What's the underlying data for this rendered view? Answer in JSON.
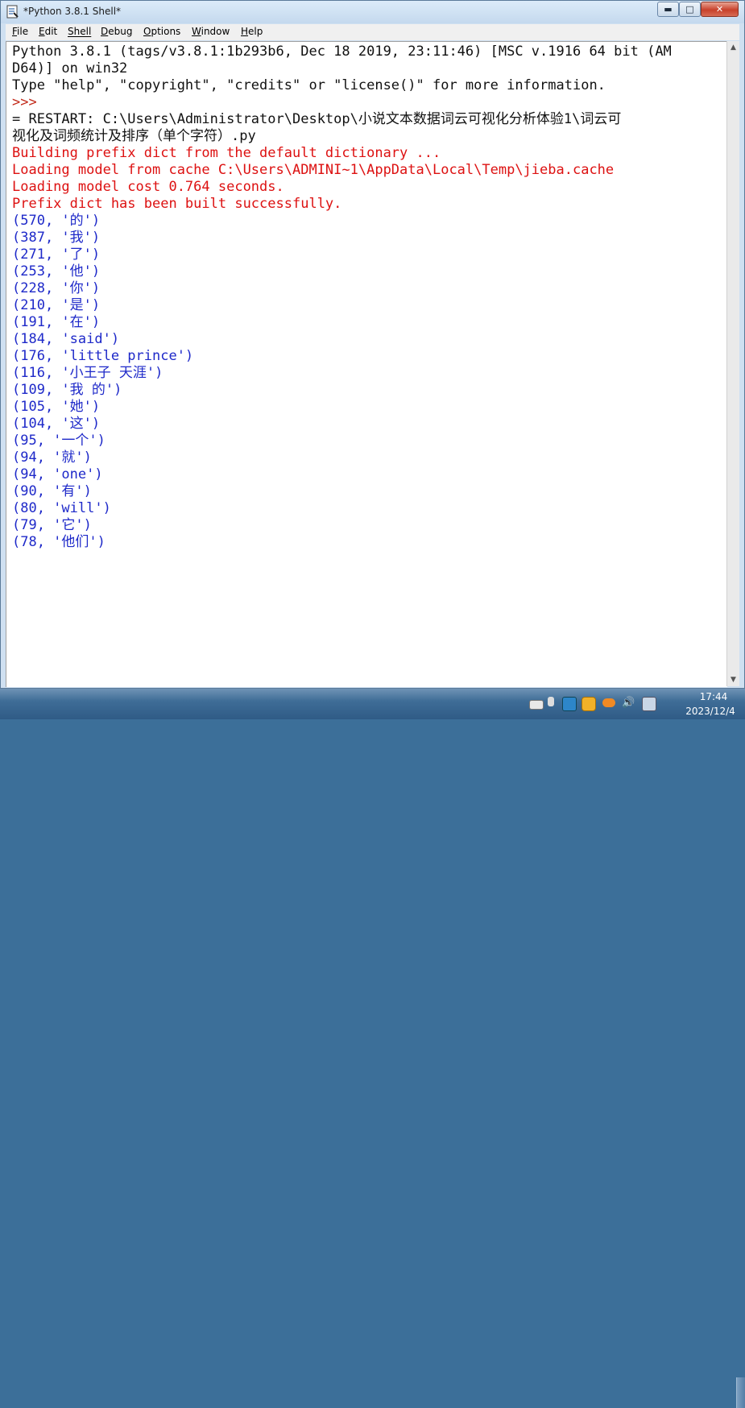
{
  "window": {
    "title": "*Python 3.8.1 Shell*",
    "controls": {
      "minimize": "▬",
      "maximize": "□",
      "close": "✕"
    }
  },
  "menubar": {
    "items": [
      {
        "label": "File",
        "mnemonic": "F",
        "rest": "ile"
      },
      {
        "label": "Edit",
        "mnemonic": "E",
        "rest": "dit"
      },
      {
        "label": "Shell",
        "mnemonic": "",
        "rest": "Shell"
      },
      {
        "label": "Debug",
        "mnemonic": "D",
        "rest": "ebug"
      },
      {
        "label": "Options",
        "mnemonic": "O",
        "rest": "ptions"
      },
      {
        "label": "Window",
        "mnemonic": "W",
        "rest": "indow"
      },
      {
        "label": "Help",
        "mnemonic": "H",
        "rest": "elp"
      }
    ]
  },
  "shell": {
    "lines": [
      {
        "kind": "out",
        "text": "Python 3.8.1 (tags/v3.8.1:1b293b6, Dec 18 2019, 23:11:46) [MSC v.1916 64 bit (AM"
      },
      {
        "kind": "out",
        "text": "D64)] on win32"
      },
      {
        "kind": "out",
        "text": "Type \"help\", \"copyright\", \"credits\" or \"license()\" for more information."
      },
      {
        "kind": "prompt",
        "text": ">>>"
      },
      {
        "kind": "out",
        "text": "= RESTART: C:\\Users\\Administrator\\Desktop\\小说文本数据词云可视化分析体验1\\词云可"
      },
      {
        "kind": "out",
        "text": "视化及词频统计及排序（单个字符）.py"
      },
      {
        "kind": "err",
        "text": "Building prefix dict from the default dictionary ..."
      },
      {
        "kind": "err",
        "text": "Loading model from cache C:\\Users\\ADMINI~1\\AppData\\Local\\Temp\\jieba.cache"
      },
      {
        "kind": "err",
        "text": "Loading model cost 0.764 seconds."
      },
      {
        "kind": "err",
        "text": "Prefix dict has been built successfully."
      },
      {
        "kind": "res",
        "text": "(570, '的')"
      },
      {
        "kind": "res",
        "text": "(387, '我')"
      },
      {
        "kind": "res",
        "text": "(271, '了')"
      },
      {
        "kind": "res",
        "text": "(253, '他')"
      },
      {
        "kind": "res",
        "text": "(228, '你')"
      },
      {
        "kind": "res",
        "text": "(210, '是')"
      },
      {
        "kind": "res",
        "text": "(191, '在')"
      },
      {
        "kind": "res",
        "text": "(184, 'said')"
      },
      {
        "kind": "res",
        "text": "(176, 'little prince')"
      },
      {
        "kind": "res",
        "text": "(116, '小王子 天涯')"
      },
      {
        "kind": "res",
        "text": "(109, '我 的')"
      },
      {
        "kind": "res",
        "text": "(105, '她')"
      },
      {
        "kind": "res",
        "text": "(104, '这')"
      },
      {
        "kind": "res",
        "text": "(95, '一个')"
      },
      {
        "kind": "res",
        "text": "(94, '就')"
      },
      {
        "kind": "res",
        "text": "(94, 'one')"
      },
      {
        "kind": "res",
        "text": "(90, '有')"
      },
      {
        "kind": "res",
        "text": "(80, 'will')"
      },
      {
        "kind": "res",
        "text": "(79, '它')"
      },
      {
        "kind": "res",
        "text": "(78, '他们')"
      }
    ]
  },
  "taskbar": {
    "tray_icons": [
      "keyboard-icon",
      "flag-icon",
      "network-app-icon",
      "qq-icon",
      "cloud-icon",
      "volume-icon",
      "security-icon"
    ],
    "clock_time": "17:44",
    "clock_date": "2023/12/4"
  },
  "colors": {
    "output": "#111111",
    "prompt": "#c22a1a",
    "stderr": "#dd1111",
    "result": "#1e29c9"
  }
}
